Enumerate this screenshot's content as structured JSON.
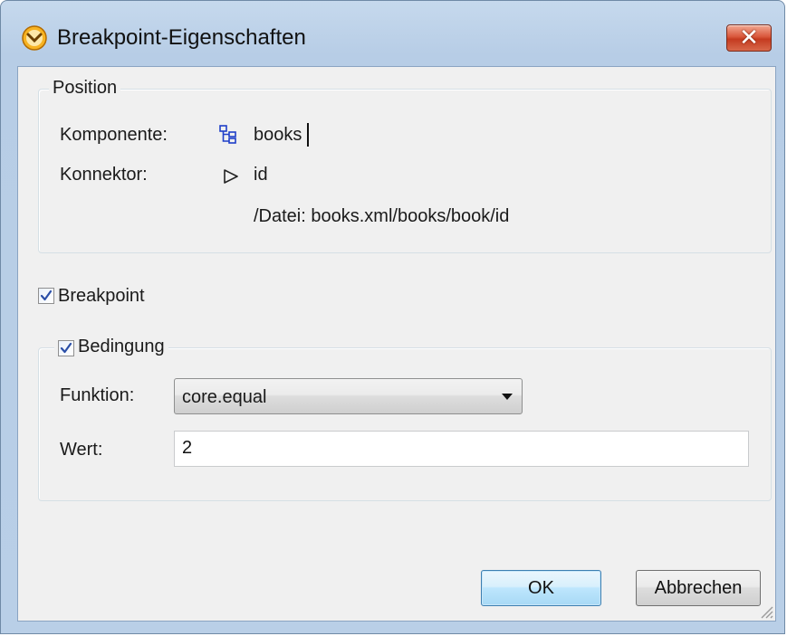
{
  "dialog": {
    "title": "Breakpoint-Eigenschaften",
    "close_label": "✕"
  },
  "position_group": {
    "legend": "Position",
    "komponente_label": "Komponente:",
    "komponente_value": "books",
    "konnektor_label": "Konnektor:",
    "konnektor_value": "id",
    "path": "/Datei: books.xml/books/book/id"
  },
  "breakpoint": {
    "label": "Breakpoint",
    "checked": true
  },
  "condition_group": {
    "legend": "Bedingung",
    "checked": true,
    "funktion_label": "Funktion:",
    "funktion_value": "core.equal",
    "wert_label": "Wert:",
    "wert_value": "2"
  },
  "buttons": {
    "ok_label": "OK",
    "cancel_label": "Abbrechen"
  },
  "colors": {
    "title_gradient_top": "#c6d9ed",
    "client_background": "#f0f0f0",
    "ok_button_border": "#3c7fb1",
    "close_button_red": "#c43b20"
  },
  "icons": [
    "breakpoint-icon",
    "close-icon",
    "component-tree-icon",
    "connector-triangle-icon",
    "check-icon",
    "dropdown-arrow-icon",
    "resize-grip-icon"
  ]
}
